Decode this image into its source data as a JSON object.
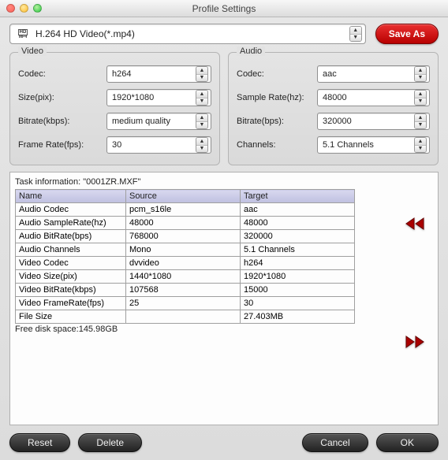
{
  "window": {
    "title": "Profile Settings"
  },
  "profile": {
    "label": "H.264 HD Video(*.mp4)",
    "icon_top": "HD",
    "icon_bottom": "MP4"
  },
  "buttons": {
    "save_as": "Save As",
    "reset": "Reset",
    "delete": "Delete",
    "cancel": "Cancel",
    "ok": "OK"
  },
  "video": {
    "title": "Video",
    "codec_label": "Codec:",
    "codec_value": "h264",
    "size_label": "Size(pix):",
    "size_value": "1920*1080",
    "bitrate_label": "Bitrate(kbps):",
    "bitrate_value": "medium quality",
    "fps_label": "Frame Rate(fps):",
    "fps_value": "30"
  },
  "audio": {
    "title": "Audio",
    "codec_label": "Codec:",
    "codec_value": "aac",
    "sr_label": "Sample Rate(hz):",
    "sr_value": "48000",
    "bitrate_label": "Bitrate(bps):",
    "bitrate_value": "320000",
    "channels_label": "Channels:",
    "channels_value": "5.1 Channels"
  },
  "task": {
    "title": "Task information: \"0001ZR.MXF\"",
    "headers": {
      "name": "Name",
      "source": "Source",
      "target": "Target"
    },
    "rows": [
      {
        "name": "Audio Codec",
        "source": "pcm_s16le",
        "target": "aac"
      },
      {
        "name": "Audio SampleRate(hz)",
        "source": "48000",
        "target": "48000"
      },
      {
        "name": "Audio BitRate(bps)",
        "source": "768000",
        "target": "320000"
      },
      {
        "name": "Audio Channels",
        "source": "Mono",
        "target": "5.1 Channels"
      },
      {
        "name": "Video Codec",
        "source": "dvvideo",
        "target": "h264"
      },
      {
        "name": "Video Size(pix)",
        "source": "1440*1080",
        "target": "1920*1080"
      },
      {
        "name": "Video BitRate(kbps)",
        "source": "107568",
        "target": "15000"
      },
      {
        "name": "Video FrameRate(fps)",
        "source": "25",
        "target": "30"
      },
      {
        "name": "File Size",
        "source": "",
        "target": "27.403MB"
      }
    ],
    "free_space": "Free disk space:145.98GB"
  }
}
